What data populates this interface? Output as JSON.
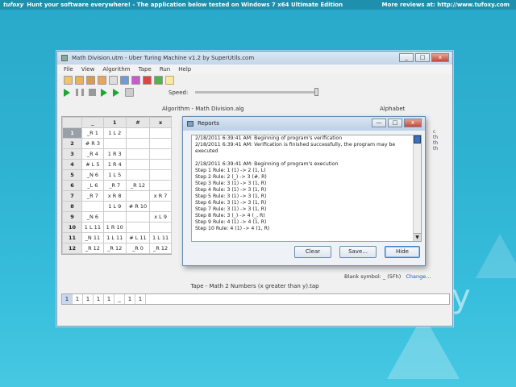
{
  "topbar": {
    "brand": "tufoxy",
    "left_text": "Hunt your software everywhere!  -  The application below tested on Windows 7 x64 Ultimate Edition",
    "right_text": "More reviews at: http://www.tufoxy.com"
  },
  "watermark": {
    "letter": "y"
  },
  "window": {
    "title": "Math Division.utm - Uber Turing Machine v1.2 by SuperUtils.com",
    "controls": {
      "minimize": "_",
      "maximize": "□",
      "close": "x"
    },
    "menu": [
      "File",
      "View",
      "Algorithm",
      "Tape",
      "Run",
      "Help"
    ],
    "speed_label": "Speed:",
    "algorithm_header": "Algorithm - Math Division.alg",
    "alphabet_header": "Alphabet",
    "grid": {
      "headers": [
        "",
        "_",
        "1",
        "#",
        "x"
      ],
      "rows": [
        [
          "1",
          "_R 1",
          "1 L 2",
          "",
          ""
        ],
        [
          "2",
          "# R 3",
          "",
          "",
          ""
        ],
        [
          "3",
          "_R 4",
          "1 R 3",
          "",
          ""
        ],
        [
          "4",
          "# L 5",
          "1 R 4",
          "",
          ""
        ],
        [
          "5",
          "_N 6",
          "1 L 5",
          "",
          ""
        ],
        [
          "6",
          "_L 6",
          "_R 7",
          "_R 12",
          ""
        ],
        [
          "7",
          "_R 7",
          "x R 8",
          "",
          "x R 7"
        ],
        [
          "8",
          "",
          "1 L 9",
          "# R 10",
          ""
        ],
        [
          "9",
          "_N 6",
          "",
          "",
          "x L 9"
        ],
        [
          "10",
          "1 L 11",
          "1 R 10",
          "",
          ""
        ],
        [
          "11",
          "_N 11",
          "1 L 11",
          "# L 11",
          "1 L 11"
        ],
        [
          "12",
          "_R 12",
          "_R 12",
          "_R 0",
          "_R 12"
        ]
      ]
    },
    "alphabet_fragments": [
      "c",
      "th",
      "th",
      "th"
    ],
    "blank_symbol": {
      "label": "Blank symbol: _ (5Fh)",
      "link": "Change..."
    },
    "tape_header": "Tape - Math 2 Numbers (x greater than y).tap",
    "tape": [
      "1",
      "1",
      "1",
      "1",
      "1",
      "_",
      "1",
      "1"
    ]
  },
  "dialog": {
    "title": "Reports",
    "controls": {
      "minimize": "—",
      "maximize": "□",
      "close": "x"
    },
    "lines": [
      "2/18/2011 6:39:41 AM: Beginning of program's verification",
      "2/18/2011 6:39:41 AM: Verification is finished successfully, the program may be",
      "executed",
      "",
      "2/18/2011 6:39:41 AM: Beginning of program's execution",
      "Step 1  Rule: 1 (1) -> 2 (1, L)",
      "Step 2  Rule: 2 (_) -> 3 (#, R)",
      "Step 3  Rule: 3 (1) -> 3 (1, R)",
      "Step 4  Rule: 3 (1) -> 3 (1, R)",
      "Step 5  Rule: 3 (1) -> 3 (1, R)",
      "Step 6  Rule: 3 (1) -> 3 (1, R)",
      "Step 7  Rule: 3 (1) -> 3 (1, R)",
      "Step 8  Rule: 3 (_) -> 4 (_, R)",
      "Step 9  Rule: 4 (1) -> 4 (1, R)",
      "Step 10  Rule: 4 (1) -> 4 (1, R)"
    ],
    "buttons": {
      "clear": "Clear",
      "save": "Save...",
      "hide": "Hide"
    }
  }
}
